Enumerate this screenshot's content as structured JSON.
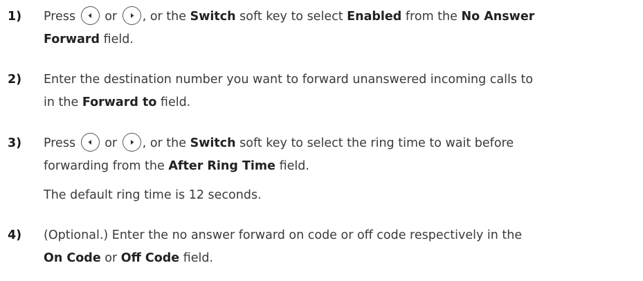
{
  "steps": [
    {
      "number": "1)",
      "line1": {
        "press": "Press",
        "or": "or",
        "after_keys": ", or the",
        "switch": "Switch",
        "mid": "soft key to select",
        "enabled": "Enabled",
        "from": "from the",
        "field_a": "No Answer"
      },
      "line2": {
        "field_b": "Forward",
        "end": "field."
      },
      "icons": [
        "left-arrow-key-icon",
        "right-arrow-key-icon"
      ]
    },
    {
      "number": "2)",
      "line1": "Enter the destination number you want to forward unanswered incoming calls to",
      "line2": {
        "start": "in the",
        "field": "Forward to",
        "end": "field."
      }
    },
    {
      "number": "3)",
      "line1": {
        "press": "Press",
        "or": "or",
        "after_keys": ", or the",
        "switch": "Switch",
        "rest": "soft key to select the ring time to wait before"
      },
      "line2": {
        "start": "forwarding from the",
        "field": "After Ring Time",
        "end": "field."
      },
      "note": "The default ring time is 12 seconds.",
      "icons": [
        "left-arrow-key-icon",
        "right-arrow-key-icon"
      ]
    },
    {
      "number": "4)",
      "line1": "(Optional.) Enter the no answer forward on code or off code respectively in the",
      "line2": {
        "field_a": "On Code",
        "or": "or",
        "field_b": "Off Code",
        "end": "field."
      }
    }
  ],
  "colors": {
    "text": "#3a3a3a",
    "bold": "#222222",
    "key_border": "#555555"
  }
}
